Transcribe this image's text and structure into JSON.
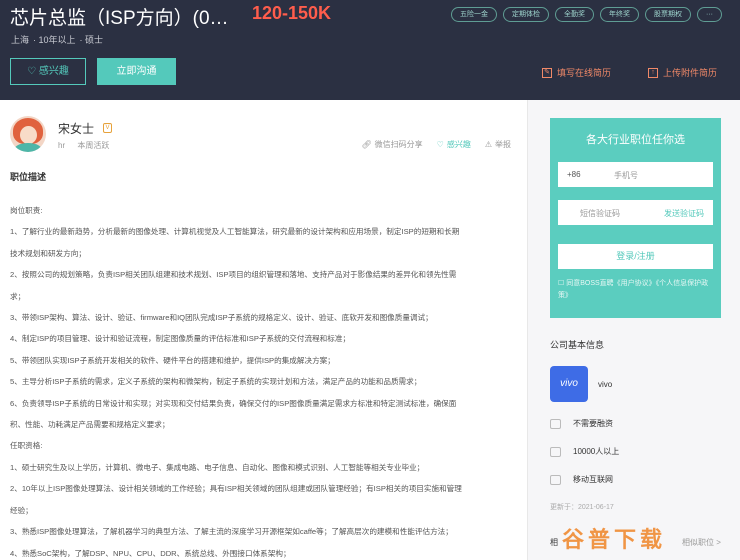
{
  "header": {
    "title": "芯片总监（ISP方向）(0…",
    "salary": "120-150K",
    "meta": [
      "上海",
      "10年以上",
      "硕士"
    ],
    "tags": [
      "五险一金",
      "定期体检",
      "全勤奖",
      "年终奖",
      "股票期权",
      "···"
    ],
    "interest_label": "感兴趣",
    "chat_label": "立即沟通",
    "fill_resume_label": "填写在线简历",
    "upload_resume_label": "上传附件简历"
  },
  "recruiter": {
    "name": "宋女士",
    "role": "hr",
    "active": "本周活跃",
    "share_label": "微信扫码分享",
    "interest_label": "感兴趣",
    "report_label": "举报"
  },
  "job": {
    "section_title": "职位描述",
    "lines": [
      "岗位职责:",
      "1、了解行业的最新趋势，分析最新的图像处理、计算机视觉及人工智能算法，研究最新的设计架构和应用场景，制定ISP的短期和长期",
      "技术规划和研发方向；",
      "2、按照公司的规划策略，负责ISP相关团队组建和技术规划、ISP项目的组织管理和落地、支持产品对于影像结果的差异化和领先性需",
      "求；",
      "3、带领ISP架构、算法、设计、验证、firmware和IQ团队完成ISP子系统的规格定义、设计、验证、底软开发和图像质量调试；",
      "4、制定ISP的项目管理、设计和验证流程，制定图像质量的评估标准和ISP子系统的交付流程和标准；",
      "5、带领团队实现ISP子系统开发相关的软件、硬件平台的搭建和维护，提供ISP的集成解决方案；",
      "5、主导分析ISP子系统的需求，定义子系统的架构和微架构，制定子系统的实现计划和方法，满足产品的功能和品质需求；",
      "6、负责领导ISP子系统的日常设计和实现；对实现和交付结果负责，确保交付的ISP图像质量满足需求方标准和特定测试标准，确保面",
      "积、性能、功耗满足产品需要和规格定义要求；",
      "任职资格:",
      "1、硕士研究生及以上学历，计算机、微电子、集成电路、电子信息、自动化、图像和模式识别、人工智能等相关专业毕业；",
      "2、10年以上ISP图像处理算法、设计相关领域的工作经验；具有ISP相关领域的团队组建或团队管理经验；有ISP相关的项目实施和管理",
      "经验；",
      "3、熟悉ISP图像处理算法，了解机器学习的典型方法、了解主流的深度学习开源框架如caffe等；了解高层次的建模和性能评估方法；",
      "4、熟悉SoC架构，了解DSP、NPU、CPU、DDR、系统总线、外围接口体系架构；"
    ]
  },
  "login": {
    "title": "各大行业职位任你选",
    "country_code": "+86",
    "phone_placeholder": "手机号",
    "code_placeholder": "短信验证码",
    "send_code_label": "发送验证码",
    "submit_label": "登录/注册",
    "agreement": "同意BOSS直聘《用户协议》《个人信息保护政策》"
  },
  "company": {
    "section_title": "公司基本信息",
    "logo_text": "vivo",
    "name": "vivo",
    "financing": "不需要融资",
    "size": "10000人以上",
    "industry": "移动互联网",
    "updated": "更新于：2021-06-17",
    "similar_label": "相",
    "more_label": "相似职位 >"
  },
  "watermark": "谷普下载",
  "colors": {
    "accent": "#54c9bb",
    "salary": "#ff5d4c",
    "header_bg": "#2b3042",
    "resume_link": "#f08968"
  }
}
